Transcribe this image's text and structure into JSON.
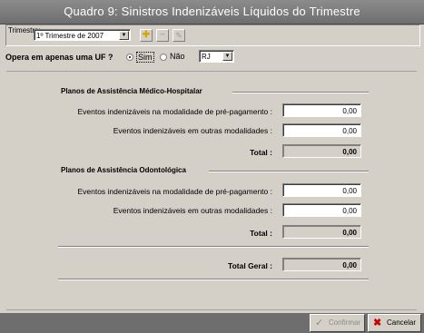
{
  "window": {
    "title": "Quadro 9: Sinistros Indenizáveis Líquidos do Trimestre"
  },
  "toolbar": {
    "trimestre_label": "Trimestre:",
    "trimestre_value": "1º Trimestre de 2007",
    "add_icon": "plus-icon",
    "remove_icon": "minus-icon",
    "edit_icon": "pencil-icon"
  },
  "uf": {
    "question": "Opera em apenas uma UF ?",
    "option_sim": "Sim",
    "option_nao": "Não",
    "selected": "Sim",
    "uf_value": "RJ"
  },
  "medico": {
    "title": "Planos de Assistência Médico-Hospitalar",
    "pre_label": "Eventos indenizáveis na modalidade de pré-pagamento :",
    "pre_value": "0,00",
    "outras_label": "Eventos indenizáveis em outras modalidades :",
    "outras_value": "0,00",
    "total_label": "Total :",
    "total_value": "0,00"
  },
  "odonto": {
    "title": "Planos de Assistência Odontológica",
    "pre_label": "Eventos indenizáveis na modalidade de pré-pagamento :",
    "pre_value": "0,00",
    "outras_label": "Eventos indenizáveis em outras modalidades :",
    "outras_value": "0,00",
    "total_label": "Total :",
    "total_value": "0,00"
  },
  "geral": {
    "label": "Total Geral :",
    "value": "0,00"
  },
  "actions": {
    "confirm_label": "Confirmar",
    "cancel_label": "Cancelar"
  },
  "colors": {
    "titlebar": "#7d7d7d",
    "face": "#d4d0c8",
    "cancel_icon": "#cc0000",
    "add_icon": "#e0c000"
  }
}
